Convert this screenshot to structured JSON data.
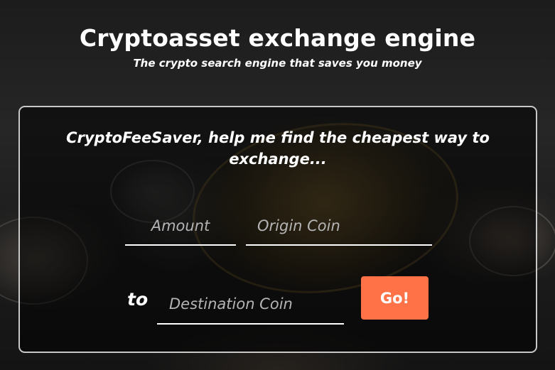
{
  "header": {
    "title": "Cryptoasset exchange engine",
    "subtitle": "The crypto search engine that saves you money"
  },
  "search": {
    "prompt": "CryptoFeeSaver, help me find the cheapest way to exchange...",
    "amount_placeholder": "Amount",
    "amount_value": "",
    "origin_placeholder": "Origin Coin",
    "origin_value": "",
    "to_label": "to",
    "destination_placeholder": "Destination Coin",
    "destination_value": "",
    "go_label": "Go!"
  },
  "colors": {
    "accent": "#ff7247",
    "panel_border": "#c8c8c8",
    "text": "#ffffff"
  }
}
